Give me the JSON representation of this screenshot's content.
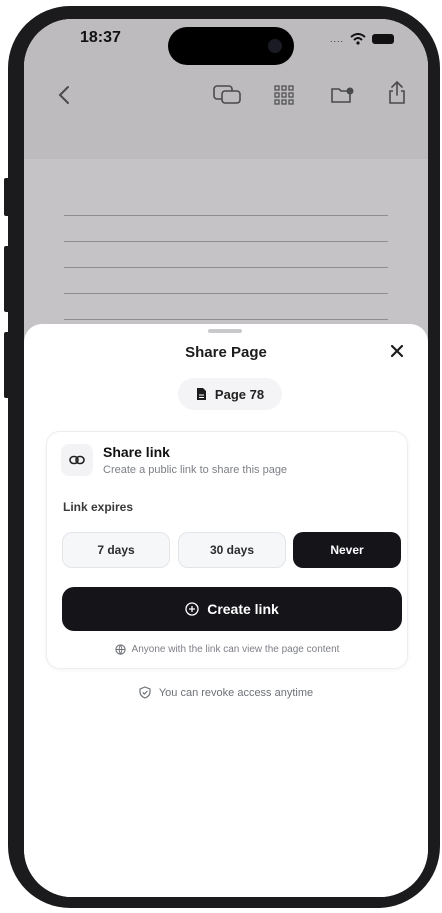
{
  "status_bar": {
    "time": "18:37"
  },
  "toolbar": {
    "icons": [
      "back-icon",
      "comments-icon",
      "grid-icon",
      "folder-icon",
      "share-icon"
    ]
  },
  "sheet": {
    "title": "Share Page",
    "close_icon": "close-icon",
    "page_chip": {
      "icon": "document-icon",
      "label": "Page 78"
    },
    "share_link": {
      "icon": "link-icon",
      "title": "Share link",
      "subtitle": "Create a public link to share this page"
    },
    "expires": {
      "label": "Link expires",
      "options": [
        "7 days",
        "30 days",
        "Never"
      ],
      "selected": "Never"
    },
    "create_button": {
      "icon": "plus-circle-icon",
      "label": "Create link"
    },
    "visibility_note": {
      "icon": "globe-icon",
      "text": "Anyone with the link can view the page content"
    },
    "revoke_note": {
      "icon": "shield-check-icon",
      "text": "You can revoke access anytime"
    }
  },
  "colors": {
    "primary": "#141419",
    "muted_text": "#7c7f86",
    "app_background": "#c5c3c6"
  }
}
